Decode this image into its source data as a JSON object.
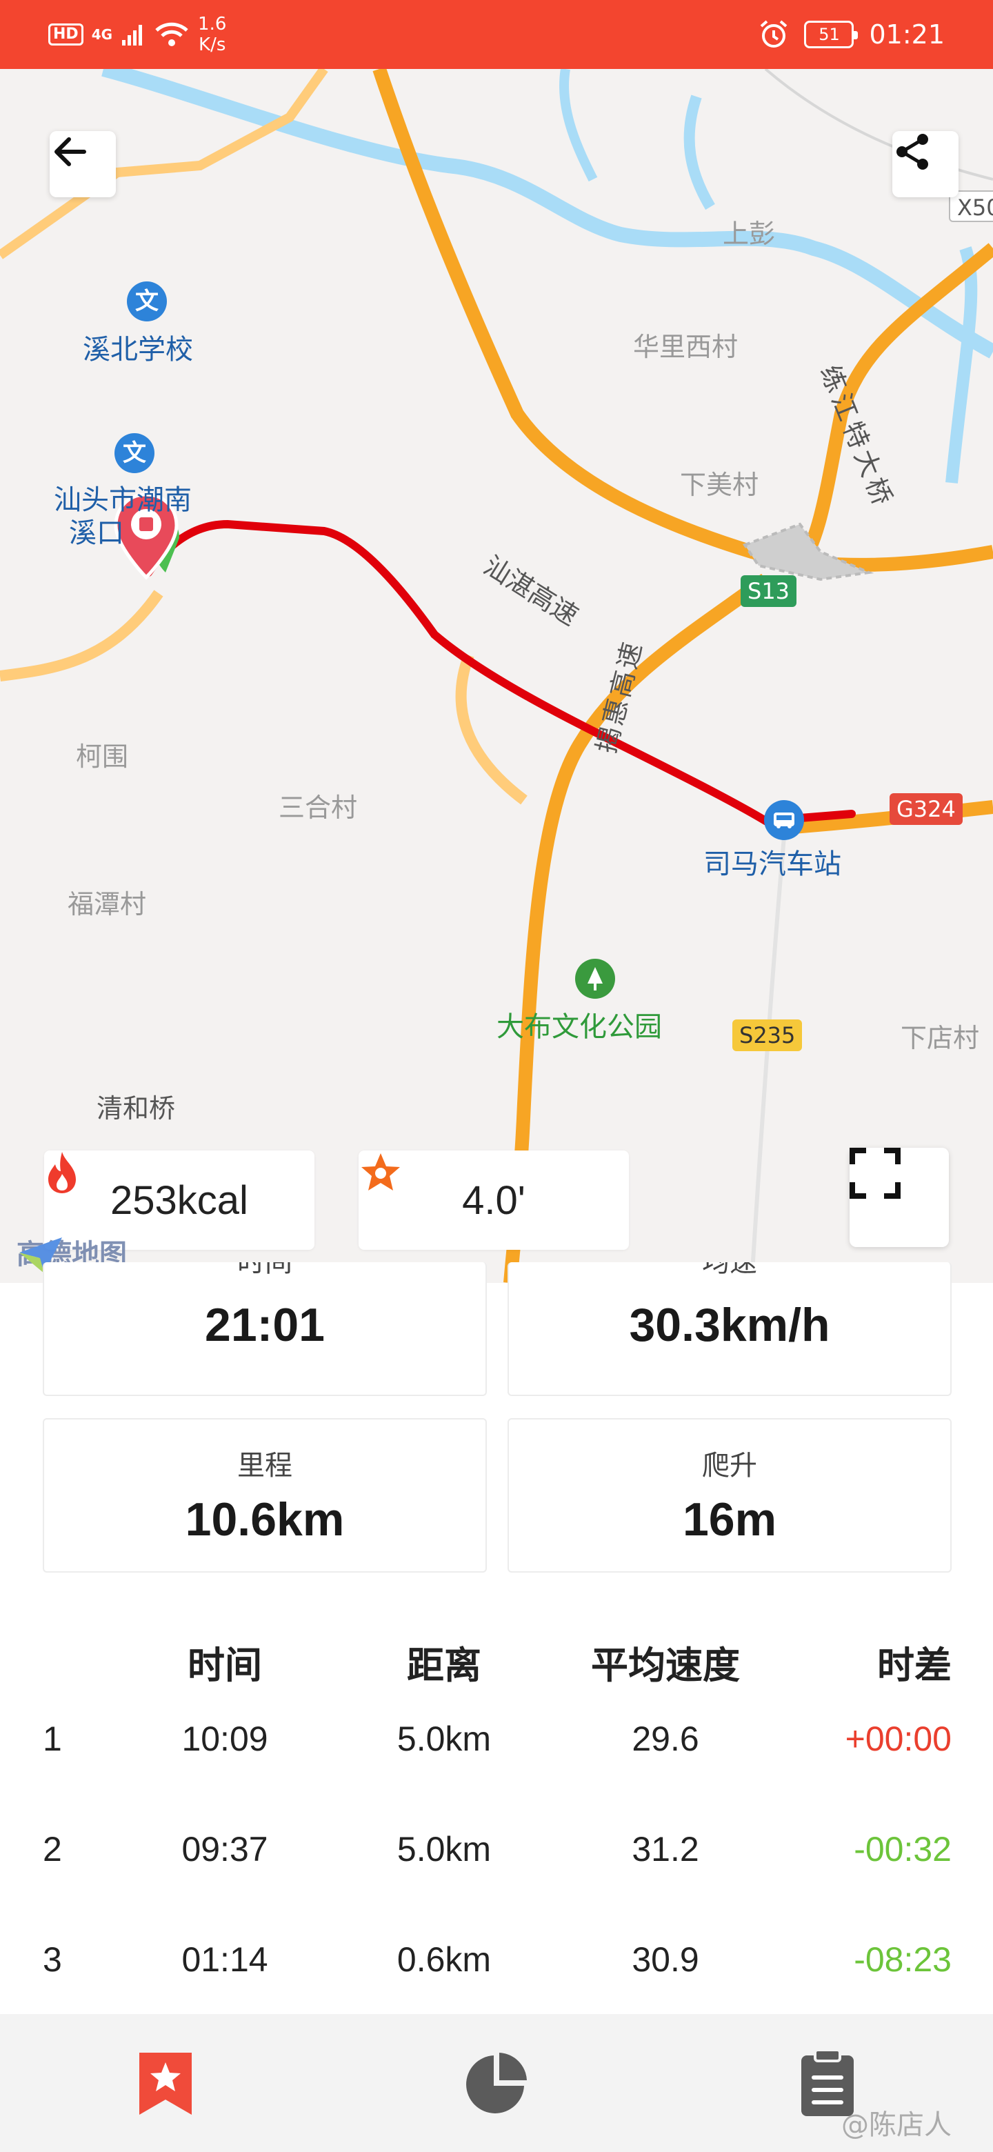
{
  "status_bar": {
    "hd": "HD",
    "network": "4G",
    "net_speed_value": "1.6",
    "net_speed_unit": "K/s",
    "battery": "51",
    "time": "01:21"
  },
  "map": {
    "labels": {
      "shangpeng": "上彭",
      "huali_xicun": "华里西村",
      "xibei_school": "溪北学校",
      "shantou_chaonan_1": "汕头市潮南",
      "shantou_chaonan_2": "溪口",
      "shanzhan_expressway": "汕湛高速",
      "lianjiang_bridge": "练江特大桥",
      "xiamei_cun": "下美村",
      "kewei": "柯围",
      "sanhe_cun": "三合村",
      "fután_cun": "福潭村",
      "jiehui_expressway": "揭惠高速",
      "sima_bus_station": "司马汽车站",
      "dabu_park": "大布文化公园",
      "xiadian_cun": "下店村",
      "qinghe_bridge": "清和桥"
    },
    "road_badges": {
      "x50": "X50",
      "s13": "S13",
      "g324": "G324",
      "s235": "S235"
    },
    "poi_glyph": "文",
    "provider_logo": "高德地图"
  },
  "chips": {
    "calories": "253kcal",
    "rating": "4.0'"
  },
  "stats": {
    "time_label": "时间",
    "time_value": "21:01",
    "speed_label": "均速",
    "speed_value": "30.3km/h",
    "distance_label": "里程",
    "distance_value": "10.6km",
    "climb_label": "爬升",
    "climb_value": "16m"
  },
  "splits": {
    "headers": [
      "时间",
      "距离",
      "平均速度",
      "时差"
    ],
    "rows": [
      {
        "idx": "1",
        "time": "10:09",
        "distance": "5.0km",
        "avg_speed": "29.6",
        "diff": "+00:00"
      },
      {
        "idx": "2",
        "time": "09:37",
        "distance": "5.0km",
        "avg_speed": "31.2",
        "diff": "-00:32"
      },
      {
        "idx": "3",
        "time": "01:14",
        "distance": "0.6km",
        "avg_speed": "30.9",
        "diff": "-08:23"
      }
    ]
  },
  "icons": {
    "back": "arrow-left-icon",
    "share": "share-icon",
    "fullscreen": "fullscreen-icon",
    "flame": "flame-icon",
    "star": "star-icon",
    "nav_record": "star-bookmark-icon",
    "nav_stats": "pie-chart-icon",
    "nav_list": "clipboard-icon"
  },
  "colors": {
    "accent": "#f3452f",
    "route": "#e0000a",
    "positive_diff": "#ea3f2e",
    "negative_diff": "#6cc43a"
  },
  "watermark": "@陈店人"
}
